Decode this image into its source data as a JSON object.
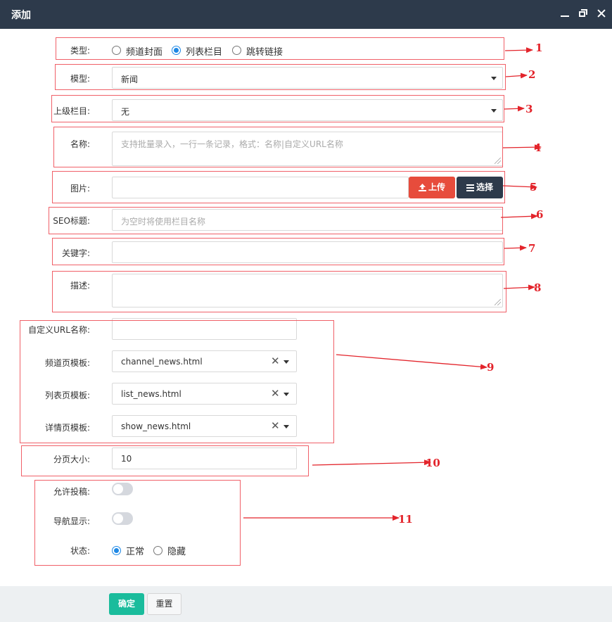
{
  "window": {
    "title": "添加"
  },
  "form": {
    "type": {
      "label": "类型:",
      "options": [
        "频道封面",
        "列表栏目",
        "跳转链接"
      ],
      "selected": 1
    },
    "model": {
      "label": "模型:",
      "value": "新闻"
    },
    "parent": {
      "label": "上级栏目:",
      "value": "无"
    },
    "name": {
      "label": "名称:",
      "placeholder": "支持批量录入，一行一条记录，格式：名称|自定义URL名称"
    },
    "image": {
      "label": "图片:",
      "value": "",
      "upload_label": "上传",
      "select_label": "选择"
    },
    "seo_title": {
      "label": "SEO标题:",
      "placeholder": "为空时将使用栏目名称"
    },
    "keywords": {
      "label": "关键字:",
      "value": ""
    },
    "description": {
      "label": "描述:",
      "value": ""
    },
    "custom_url": {
      "label": "自定义URL名称:",
      "value": ""
    },
    "channel_tpl": {
      "label": "频道页模板:",
      "value": "channel_news.html"
    },
    "list_tpl": {
      "label": "列表页模板:",
      "value": "list_news.html"
    },
    "detail_tpl": {
      "label": "详情页模板:",
      "value": "show_news.html"
    },
    "page_size": {
      "label": "分页大小:",
      "value": "10"
    },
    "allow_submit": {
      "label": "允许投稿:",
      "on": false
    },
    "nav_show": {
      "label": "导航显示:",
      "on": false
    },
    "status": {
      "label": "状态:",
      "options": [
        "正常",
        "隐藏"
      ],
      "selected": 0
    }
  },
  "footer": {
    "ok_label": "确定",
    "reset_label": "重置"
  },
  "annotations": [
    "1",
    "2",
    "3",
    "4",
    "5",
    "6",
    "7",
    "8",
    "9",
    "10",
    "11"
  ],
  "colors": {
    "titlebar": "#2d3a4b",
    "upload": "#e74c3c",
    "confirm": "#1abc9c",
    "annotation": "#e3242b",
    "radio": "#1e88e5"
  }
}
